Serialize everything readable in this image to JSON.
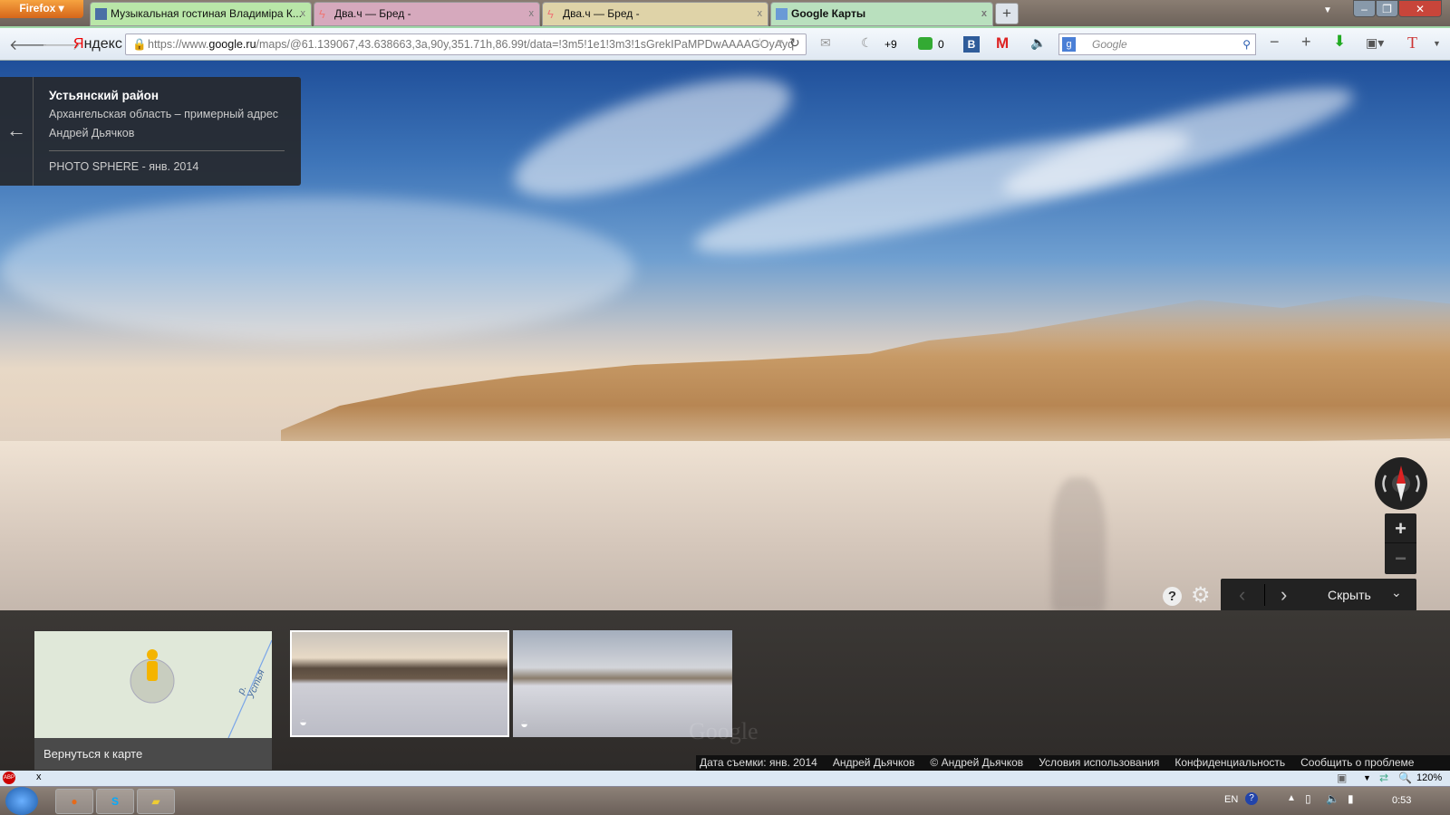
{
  "browser": {
    "menu_button": "Firefox",
    "tabs": [
      {
        "title": "Музыкальная гостиная Владиміра К...",
        "active": false
      },
      {
        "title": "Два.ч — Бред -",
        "active": false
      },
      {
        "title": "Два.ч — Бред -",
        "active": false
      },
      {
        "title": "Google Карты",
        "active": true
      }
    ],
    "new_tab": "+",
    "close_tab": "x",
    "brand": "Яндекс",
    "url_prefix": "https://www.",
    "url_domain": "google.ru",
    "url_rest": "/maps/@61.139067,43.638663,3a,90y,351.71h,86.99t/data=!3m5!1e1!3m3!1sGrekIPaMPDwAAAAGOyAyq",
    "moon_count": "+9",
    "green_count": "0",
    "search_placeholder": "Google",
    "zoom_level": "120%"
  },
  "info_card": {
    "title": "Устьянский район",
    "subtitle": "Архангельская область – примерный адрес",
    "author": "Андрей Дьячков",
    "photo_info": "PHOTO SPHERE - янв. 2014"
  },
  "controls": {
    "zoom_in": "+",
    "zoom_out": "−",
    "hide_label": "Скрыть"
  },
  "filmstrip": {
    "map_label": "Вернуться к карте",
    "river_label": "р. Устья",
    "watermark": "Google"
  },
  "attribution": [
    "Дата съемки: янв. 2014",
    "Андрей Дьячков",
    "© Андрей Дьячков",
    "Условия использования",
    "Конфиденциальность",
    "Сообщить о проблеме"
  ],
  "taskbar": {
    "lang": "EN",
    "clock": "0:53"
  }
}
